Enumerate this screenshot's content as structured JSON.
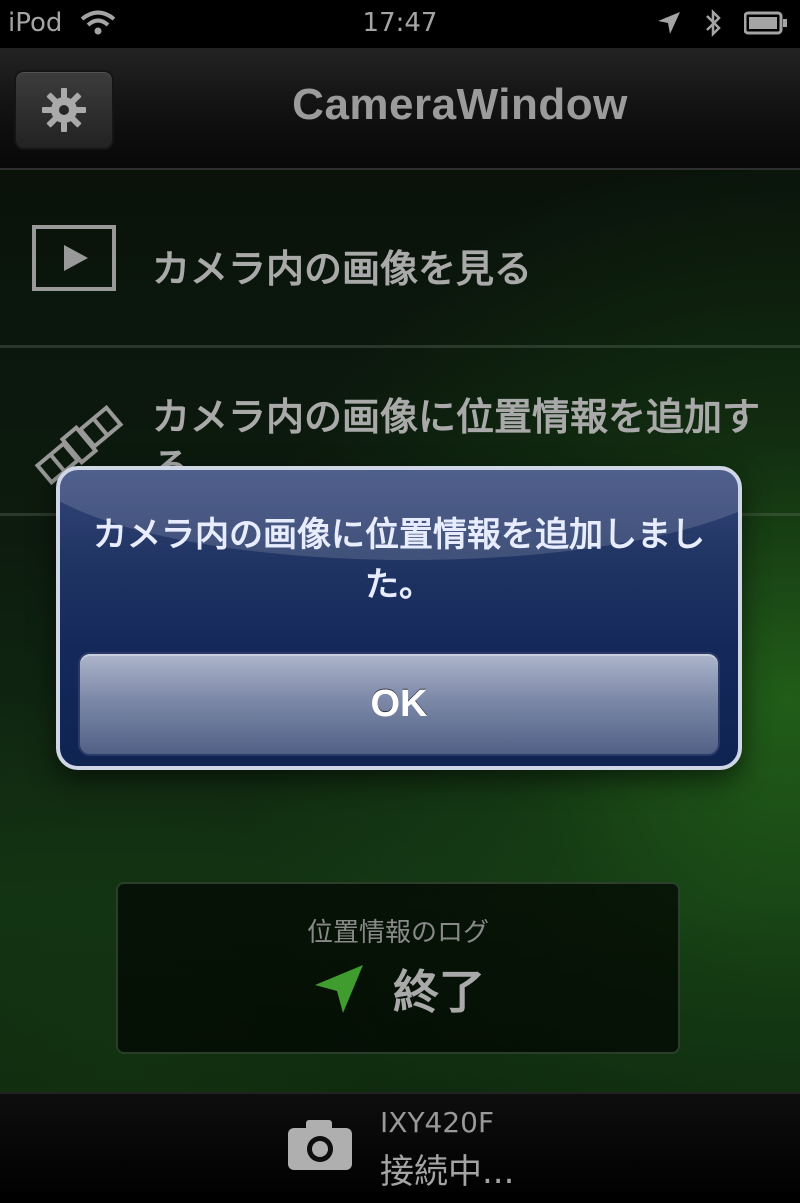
{
  "status_bar": {
    "carrier": "iPod",
    "time": "17:47",
    "icons": [
      "wifi-icon",
      "location-arrow-icon",
      "bluetooth-icon",
      "battery-icon"
    ]
  },
  "nav": {
    "title": "CameraWindow",
    "settings_icon": "gear-icon"
  },
  "menu": {
    "items": [
      {
        "label": "カメラ内の画像を見る",
        "icon": "play-icon"
      },
      {
        "label": "カメラ内の画像に位置情報を追加する",
        "icon": "satellite-icon"
      }
    ]
  },
  "alert": {
    "message": "カメラ内の画像に位置情報を追加しました。",
    "ok_label": "OK"
  },
  "log_panel": {
    "title": "位置情報のログ",
    "status": "終了",
    "icon": "location-arrow-icon",
    "accent_color": "#4fbf3a"
  },
  "bottom_bar": {
    "device_name": "IXY420F",
    "connection_status": "接続中..."
  }
}
